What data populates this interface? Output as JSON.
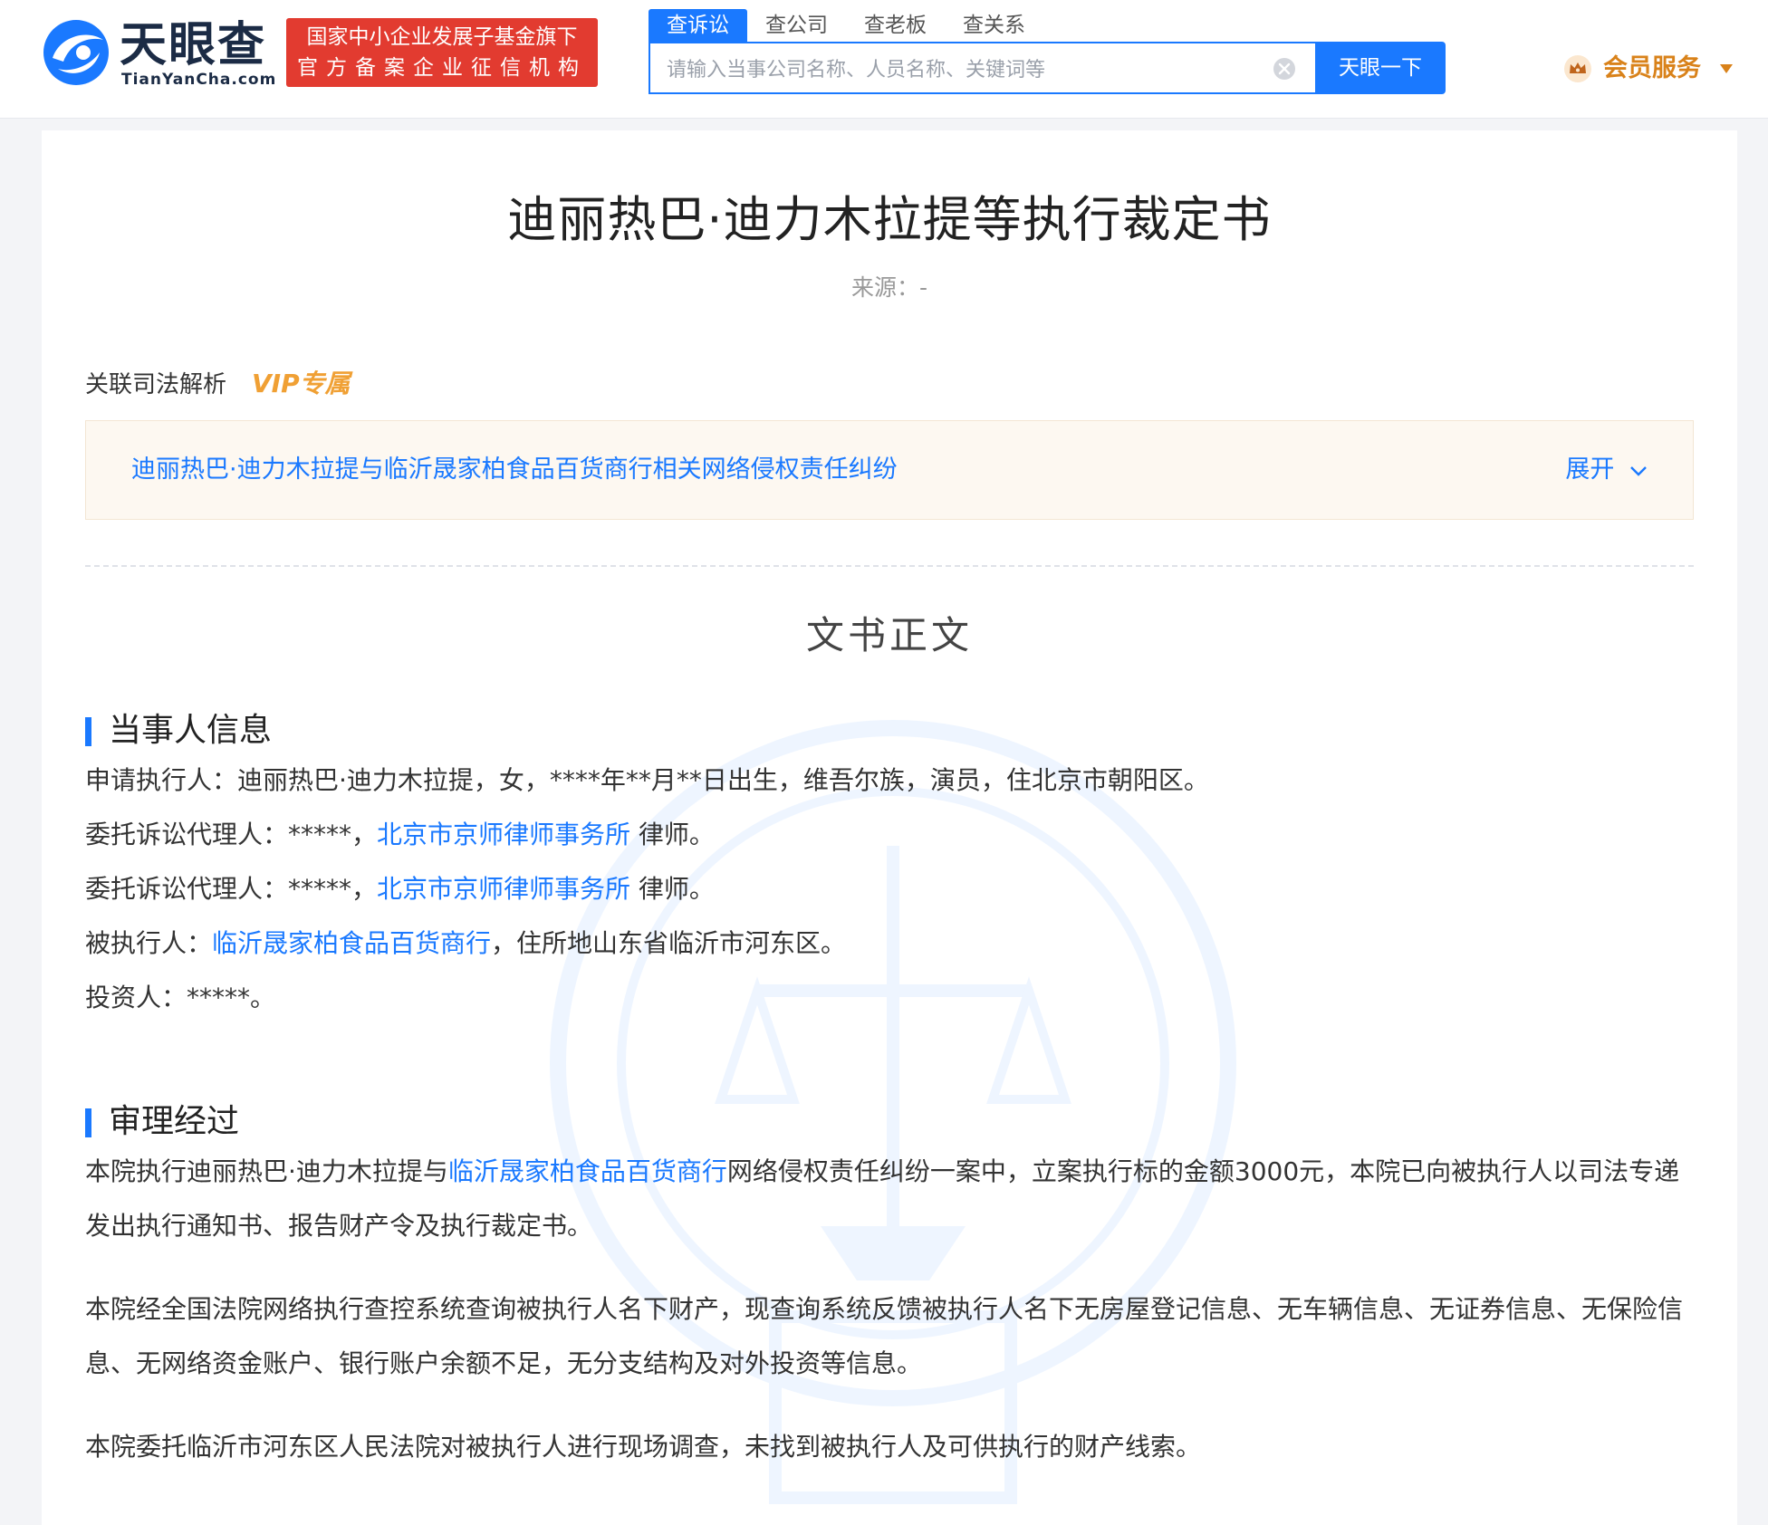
{
  "header": {
    "logo_cn": "天眼查",
    "logo_en": "TianYanCha.com",
    "badge_line1": "国家中小企业发展子基金旗下",
    "badge_line2": "官方备案企业征信机构",
    "search_tabs": [
      "查诉讼",
      "查公司",
      "查老板",
      "查关系"
    ],
    "search_placeholder": "请输入当事公司名称、人员名称、关键词等",
    "search_button": "天眼一下",
    "vip_service": "会员服务"
  },
  "document": {
    "title": "迪丽热巴·迪力木拉提等执行裁定书",
    "source_label": "来源：",
    "source_value": "-",
    "related_label": "关联司法解析",
    "vip_exclusive": "VIP专属",
    "related_case": "迪丽热巴·迪力木拉提与临沂晟家柏食品百货商行相关网络侵权责任纠纷",
    "expand_label": "展开",
    "body_title": "文书正文"
  },
  "parties": {
    "heading": "当事人信息",
    "line1": "申请执行人：迪丽热巴·迪力木拉提，女，****年**月**日出生，维吾尔族，演员，住北京市朝阳区。",
    "agent_label": "委托诉讼代理人：*****，",
    "law_firm": "北京市京师律师事务所",
    "agent_suffix": " 律师。",
    "respondent_label": "被执行人：",
    "respondent": "临沂晟家柏食品百货商行",
    "respondent_suffix": "，住所地山东省临沂市河东区。",
    "investor": "投资人：*****。"
  },
  "trial": {
    "heading": "审理经过",
    "p1_prefix": "本院执行迪丽热巴·迪力木拉提与",
    "p1_link": "临沂晟家柏食品百货商行",
    "p1_suffix": "网络侵权责任纠纷一案中，立案执行标的金额3000元，本院已向被执行人以司法专递发出执行通知书、报告财产令及执行裁定书。",
    "p2": "本院经全国法院网络执行查控系统查询被执行人名下财产，现查询系统反馈被执行人名下无房屋登记信息、无车辆信息、无证券信息、无保险信息、无网络资金账户、银行账户余额不足，无分支结构及对外投资等信息。",
    "p3": "本院委托临沂市河东区人民法院对被执行人进行现场调查，未找到被执行人及可供执行的财产线索。"
  }
}
